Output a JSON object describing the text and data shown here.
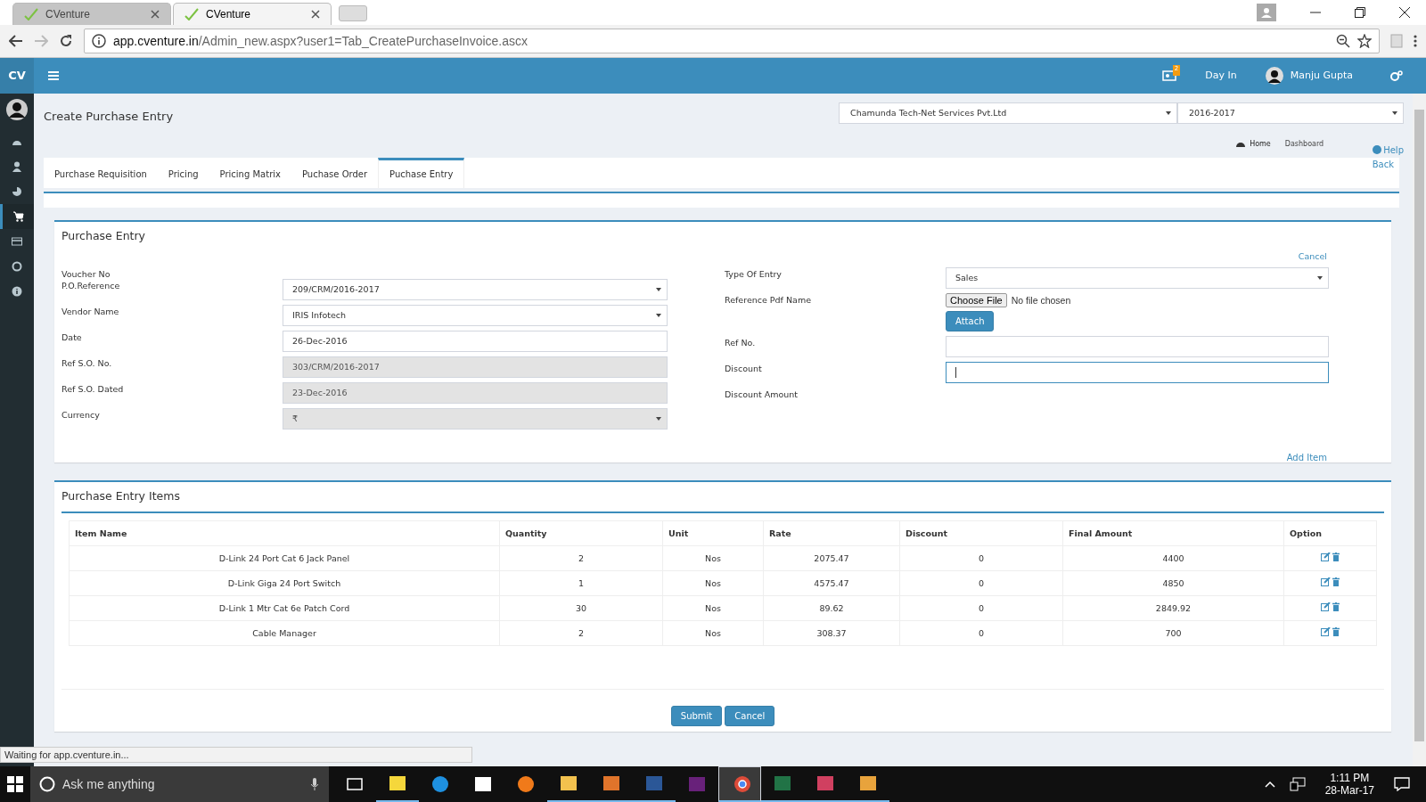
{
  "browser": {
    "tabs": [
      {
        "title": "CVenture",
        "selected": false
      },
      {
        "title": "CVenture",
        "selected": true
      }
    ],
    "url_host": "app.cventure.in",
    "url_path": "/Admin_new.aspx?user1=Tab_CreatePurchaseInvoice.ascx"
  },
  "header": {
    "logo": "CV",
    "notification_count": "2",
    "day_in": "Day In",
    "user": "Manju Gupta"
  },
  "sidebar": {
    "items": [
      {
        "kind": "dashboard",
        "selected": false
      },
      {
        "kind": "user",
        "selected": false
      },
      {
        "kind": "chart",
        "selected": false
      },
      {
        "kind": "cart",
        "selected": true
      },
      {
        "kind": "card",
        "selected": false
      },
      {
        "kind": "support",
        "selected": false
      },
      {
        "kind": "info",
        "selected": false
      }
    ]
  },
  "page": {
    "title": "Create Purchase Entry",
    "company": "Chamunda Tech-Net Services Pvt.Ltd",
    "year": "2016-2017",
    "breadcrumb": [
      "Home",
      "Dashboard"
    ],
    "help": "Help",
    "back": "Back"
  },
  "tabs": [
    {
      "label": "Purchase Requisition",
      "selected": false
    },
    {
      "label": "Pricing",
      "selected": false
    },
    {
      "label": "Pricing Matrix",
      "selected": false
    },
    {
      "label": "Puchase Order",
      "selected": false
    },
    {
      "label": "Puchase Entry",
      "selected": true
    }
  ],
  "form": {
    "title": "Purchase Entry",
    "cancel": "Cancel",
    "add_item": "Add Item",
    "left": [
      {
        "label": "Voucher No",
        "kind": "label"
      },
      {
        "label": "P.O.Reference",
        "kind": "select",
        "value": "209/CRM/2016-2017",
        "disabled": false
      },
      {
        "label": "Vendor Name",
        "kind": "select",
        "value": "IRIS Infotech",
        "disabled": false
      },
      {
        "label": "Date",
        "kind": "input",
        "value": "26-Dec-2016",
        "disabled": false
      },
      {
        "label": "Ref S.O. No.",
        "kind": "input",
        "value": "303/CRM/2016-2017",
        "disabled": true
      },
      {
        "label": "Ref S.O. Dated",
        "kind": "input",
        "value": "23-Dec-2016",
        "disabled": true
      },
      {
        "label": "Currency",
        "kind": "select",
        "value": "₹",
        "disabled": true
      }
    ],
    "right": [
      {
        "label": "Type Of Entry",
        "kind": "select",
        "value": "Sales",
        "focused": false
      },
      {
        "label": "Reference Pdf Name",
        "kind": "file",
        "choose": "Choose File",
        "status": "No file chosen",
        "attach": "Attach"
      },
      {
        "label": "Ref No.",
        "kind": "input",
        "focused": false
      },
      {
        "label": "Discount",
        "kind": "input",
        "focused": true
      },
      {
        "label": "Discount Amount",
        "kind": "label"
      }
    ]
  },
  "items": {
    "title": "Purchase Entry Items",
    "columns": [
      "Item Name",
      "Quantity",
      "Unit",
      "Rate",
      "Discount",
      "Final Amount",
      "Option"
    ],
    "rows": [
      [
        "D-Link 24 Port Cat 6 Jack Panel",
        "2",
        "Nos",
        "2075.47",
        "0",
        "4400"
      ],
      [
        "D-Link Giga 24 Port Switch",
        "1",
        "Nos",
        "4575.47",
        "0",
        "4850"
      ],
      [
        "D-Link 1 Mtr Cat 6e Patch Cord",
        "30",
        "Nos",
        "89.62",
        "0",
        "2849.92"
      ],
      [
        "Cable Manager",
        "2",
        "Nos",
        "308.37",
        "0",
        "700"
      ]
    ]
  },
  "buttons": [
    "Submit",
    "Cancel"
  ],
  "status": "Waiting for app.cventure.in...",
  "taskbar": {
    "search_placeholder": "Ask me anything",
    "time": "1:11 PM",
    "date": "28-Mar-17",
    "apps": [
      {
        "kind": "taskview",
        "open": false,
        "selected": false
      },
      {
        "kind": "notes",
        "open": true,
        "selected": false
      },
      {
        "kind": "edge",
        "open": false,
        "selected": false
      },
      {
        "kind": "store",
        "open": false,
        "selected": false
      },
      {
        "kind": "flame",
        "open": false,
        "selected": false
      },
      {
        "kind": "folder",
        "open": true,
        "selected": false
      },
      {
        "kind": "mail",
        "open": true,
        "selected": false
      },
      {
        "kind": "word",
        "open": true,
        "selected": false
      },
      {
        "kind": "studio",
        "open": false,
        "selected": false
      },
      {
        "kind": "chrome",
        "open": true,
        "selected": true
      },
      {
        "kind": "excel",
        "open": true,
        "selected": false
      },
      {
        "kind": "paint",
        "open": true,
        "selected": false
      },
      {
        "kind": "palette",
        "open": true,
        "selected": false
      }
    ]
  }
}
